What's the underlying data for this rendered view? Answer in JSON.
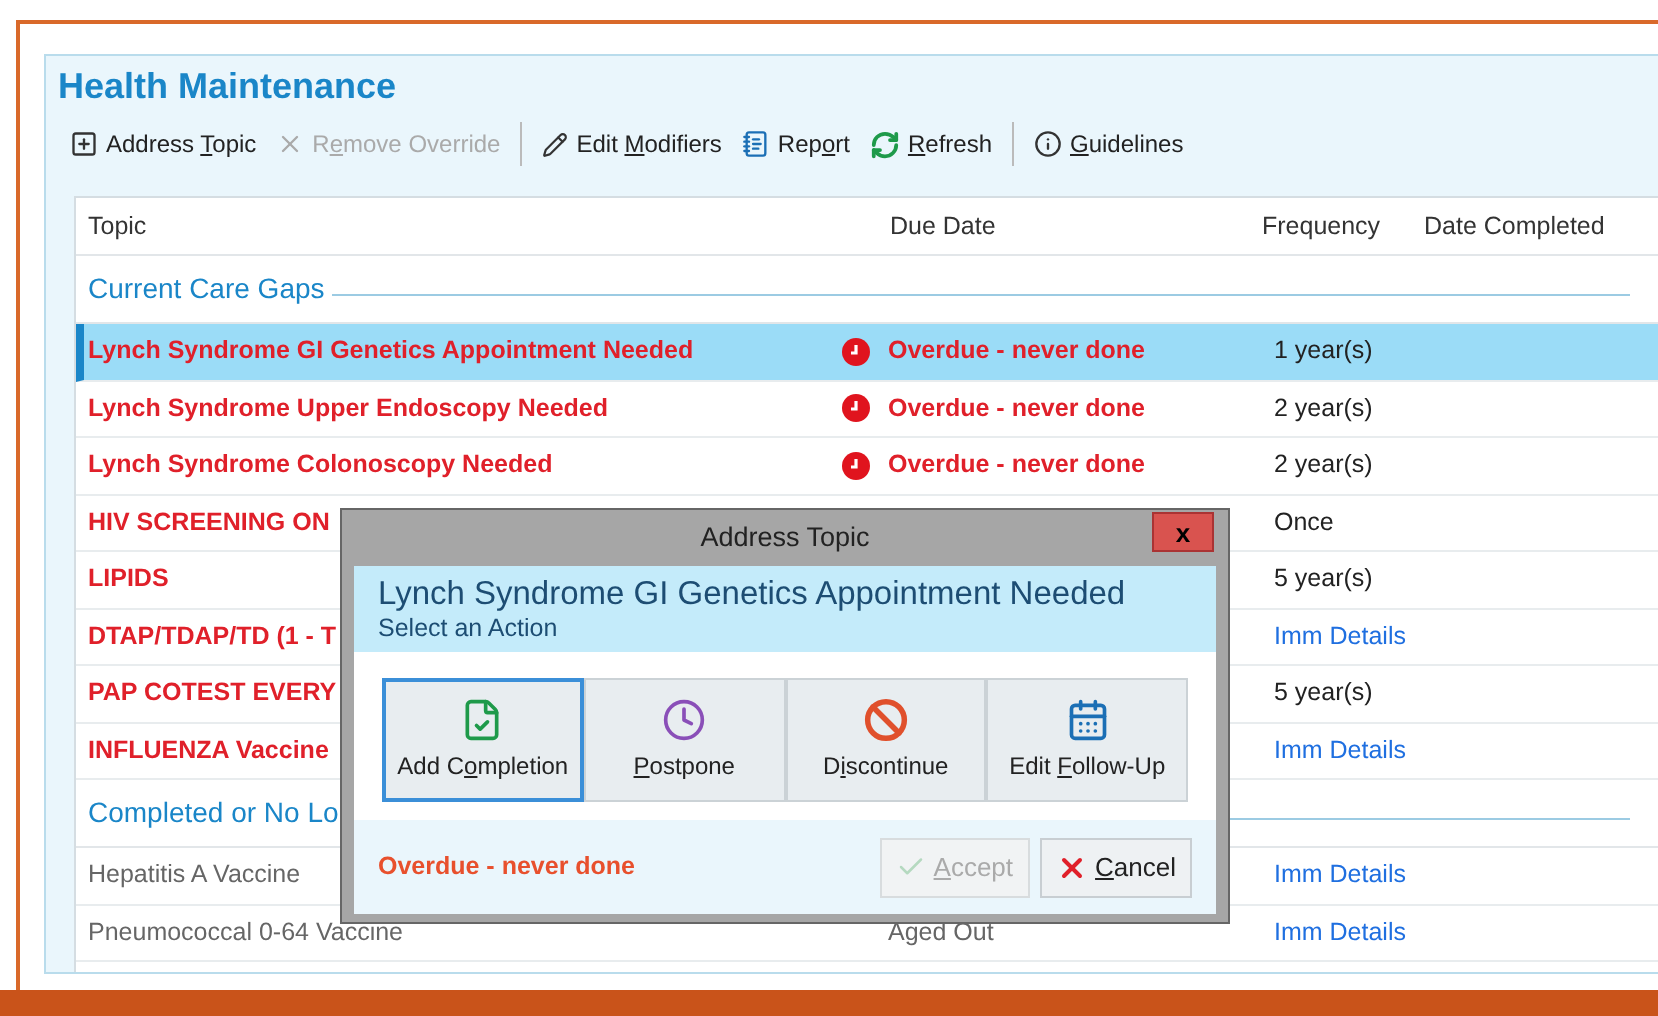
{
  "title": "Health Maintenance",
  "toolbar": [
    {
      "kind": "button",
      "label": {
        "pre": "Address ",
        "key": "T",
        "post": "opic"
      },
      "disabled": false
    },
    {
      "kind": "button",
      "label": {
        "pre": "R",
        "key": "e",
        "post": "move Override"
      },
      "disabled": true
    },
    {
      "kind": "separator"
    },
    {
      "kind": "button",
      "label": {
        "pre": "Edit ",
        "key": "M",
        "post": "odifiers"
      },
      "disabled": false
    },
    {
      "kind": "button",
      "label": {
        "pre": "Rep",
        "key": "o",
        "post": "rt"
      },
      "disabled": false
    },
    {
      "kind": "button",
      "label": {
        "key": "R",
        "post": "efresh"
      },
      "disabled": false
    },
    {
      "kind": "separator"
    },
    {
      "kind": "button",
      "label": {
        "key": "G",
        "post": "uidelines"
      },
      "disabled": false
    }
  ],
  "table": {
    "columns": [
      "Topic",
      "Due Date",
      "Frequency",
      "Date Completed"
    ],
    "rows": [
      {
        "kind": "group",
        "label": "Current Care Gaps"
      },
      {
        "kind": "item",
        "topic": "Lynch Syndrome GI Genetics Appointment Needed",
        "overdue": true,
        "selected": true,
        "due_date": "Overdue - never done",
        "frequency": "1 year(s)",
        "link": false
      },
      {
        "kind": "item",
        "topic": "Lynch Syndrome Upper Endoscopy Needed",
        "overdue": true,
        "selected": false,
        "due_date": "Overdue - never done",
        "frequency": "2 year(s)",
        "link": false
      },
      {
        "kind": "item",
        "topic": "Lynch Syndrome Colonoscopy Needed",
        "overdue": true,
        "selected": false,
        "due_date": "Overdue - never done",
        "frequency": "2 year(s)",
        "link": false
      },
      {
        "kind": "item",
        "topic": "HIV SCREENING ON",
        "overdue": true,
        "selected": false,
        "frequency": "Once",
        "link": false
      },
      {
        "kind": "item",
        "topic": "LIPIDS",
        "overdue": true,
        "selected": false,
        "frequency": "5 year(s)",
        "link": false
      },
      {
        "kind": "item",
        "topic": "DTAP/TDAP/TD (1 - T",
        "overdue": true,
        "selected": false,
        "frequency": "Imm Details",
        "link": true
      },
      {
        "kind": "item",
        "topic": "PAP COTEST EVERY",
        "overdue": true,
        "selected": false,
        "frequency": "5 year(s)",
        "link": false
      },
      {
        "kind": "item",
        "topic": "INFLUENZA Vaccine",
        "overdue": true,
        "selected": false,
        "frequency": "Imm Details",
        "link": true
      },
      {
        "kind": "group",
        "label": "Completed or No Lo"
      },
      {
        "kind": "item",
        "topic": "Hepatitis A Vaccine",
        "overdue": false,
        "selected": false,
        "frequency": "Imm Details",
        "link": true
      },
      {
        "kind": "item",
        "topic": "Pneumococcal 0-64 Vaccine",
        "overdue": false,
        "selected": false,
        "due_date": "Aged Out",
        "frequency": "Imm Details",
        "link": true
      }
    ]
  },
  "dialog": {
    "title": "Address Topic",
    "close": "x",
    "heading": "Lynch Syndrome GI Genetics Appointment Needed",
    "subheading": "Select an Action",
    "actions": [
      {
        "label": {
          "pre": "Add C",
          "key": "o",
          "post": "mpletion"
        },
        "selected": true
      },
      {
        "label": {
          "key": "P",
          "post": "ostpone"
        },
        "selected": false
      },
      {
        "label": {
          "pre": "D",
          "key": "i",
          "post": "scontinue"
        },
        "selected": false
      },
      {
        "label": {
          "pre": "Edit ",
          "key": "F",
          "post": "ollow-Up"
        },
        "selected": false
      }
    ],
    "status": "Overdue - never done",
    "buttons": [
      {
        "label": {
          "key": "A",
          "post": "ccept"
        },
        "disabled": true
      },
      {
        "label": {
          "key": "C",
          "post": "ancel"
        },
        "disabled": false
      }
    ]
  }
}
